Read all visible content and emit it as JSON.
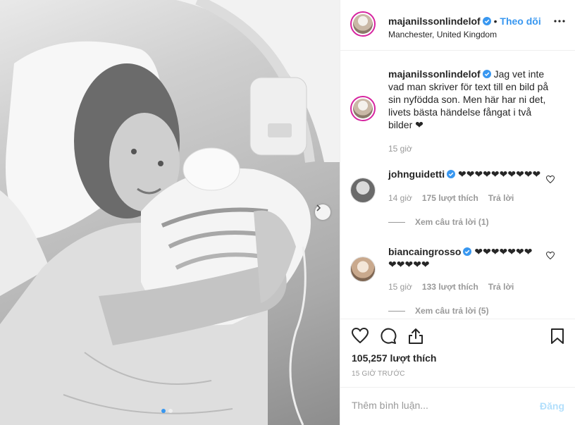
{
  "post": {
    "username": "majanilssonlindelof",
    "follow_label": "Theo dõi",
    "location": "Manchester, United Kingdom",
    "caption": "Jag vet inte vad man skriver för text till en bild på sin nyfödda son. Men här har ni det, livets bästa händelse fångat i två bilder ❤",
    "caption_time": "15 giờ",
    "likes": "105,257 lượt thích",
    "time_ago": "15 GIỜ TRƯỚC",
    "photo_dots": 2,
    "active_dot": 0
  },
  "comments": [
    {
      "username": "johnguidetti",
      "verified": true,
      "text": "❤❤❤❤❤❤❤❤❤❤",
      "time": "14 giờ",
      "likes": "175 lượt thích",
      "reply_label": "Trả lời",
      "view_replies": "Xem câu trả lời (1)"
    },
    {
      "username": "biancaingrosso",
      "verified": true,
      "text": "❤❤❤❤❤❤❤❤❤❤❤❤",
      "time": "15 giờ",
      "likes": "133 lượt thích",
      "reply_label": "Trả lời",
      "view_replies": "Xem câu trả lời (5)"
    }
  ],
  "composer": {
    "placeholder": "Thêm bình luận...",
    "post_label": "Đăng"
  },
  "colors": {
    "accent": "#3897f0",
    "ring": "#d6249f",
    "muted": "#999999"
  },
  "icons": [
    "verified-badge-icon",
    "more-options-icon",
    "heart-icon",
    "comment-icon",
    "share-icon",
    "bookmark-icon",
    "next-arrow-icon"
  ]
}
